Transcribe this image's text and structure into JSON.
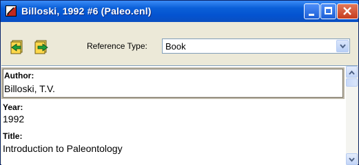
{
  "window": {
    "title": "Billoski, 1992 #6  (Paleo.enl)",
    "icon": "endnote-reference-icon",
    "controls": [
      "minimize-icon",
      "maximize-icon",
      "close-icon"
    ]
  },
  "toolbar": {
    "prev_icon": "previous-record-icon",
    "next_icon": "next-record-icon",
    "reference_type_label": "Reference Type:",
    "reference_type_value": "Book"
  },
  "fields": [
    {
      "label": "Author:",
      "value": "Billoski, T.V."
    },
    {
      "label": "Year:",
      "value": "1992"
    },
    {
      "label": "Title:",
      "value": "Introduction to Paleontology"
    }
  ],
  "colors": {
    "titlebar": "#0453d0",
    "close_button": "#c63d1f",
    "window_face": "#ece9d8",
    "field_border": "#7f9db9"
  }
}
